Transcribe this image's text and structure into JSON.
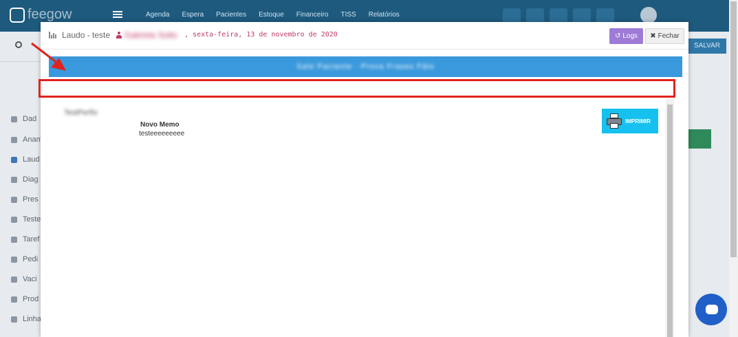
{
  "app": {
    "brand": "feegow",
    "nav": [
      "Agenda",
      "Espera",
      "Pacientes",
      "Estoque",
      "Financeiro",
      "TISS",
      "Relatórios"
    ],
    "salvar_label": "SALVAR",
    "sidebar": [
      "Dad",
      "Anam",
      "Laud",
      "Diag",
      "Pres",
      "Teste",
      "Taref",
      "Pedi",
      "Vaci",
      "Prod",
      "Linha"
    ]
  },
  "modal": {
    "title": "Laudo - teste",
    "patient_name": "Gabriela Sotto",
    "separator": ",",
    "date_text": " sexta-feira, 13 de novembro de 2020",
    "logs_label": "Logs",
    "fechar_label": "Fechar",
    "blue_bar_text": "Sale Paciente · Prova Frases Fâlo",
    "blurred_label": "TestPerfio",
    "memo_title": "Novo Memo",
    "memo_text": "testeeeeeeeee",
    "print_label": "IMPRIMIR"
  },
  "colors": {
    "topbar": "#1e5a7e",
    "accent_blue_bar": "#3a99dc",
    "logs_purple": "#9e7bd6",
    "print_cyan": "#16c1ef",
    "annotation_red": "#e0231f",
    "patient_pink": "#c0396b"
  }
}
